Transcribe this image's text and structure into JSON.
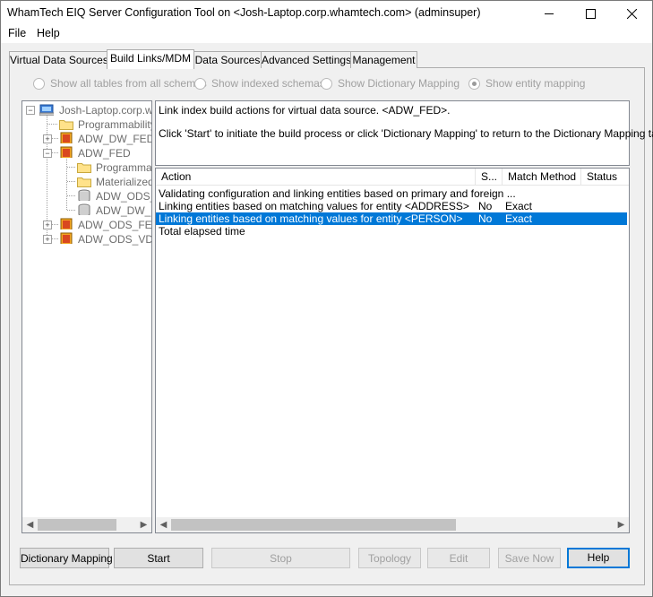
{
  "window": {
    "title": "WhamTech EIQ Server Configuration Tool on <Josh-Laptop.corp.whamtech.com> (adminsuper)",
    "minimize_glyph": "—",
    "maximize_glyph": "☐",
    "close_glyph": "✕"
  },
  "menu": [
    "File",
    "Help"
  ],
  "tabs": [
    "Virtual Data Sources",
    "Build Links/MDM",
    "Data Sources",
    "Advanced Settings",
    "Management"
  ],
  "active_tab": "Build Links/MDM",
  "radio_options": [
    {
      "label": "Show all tables from all schemas",
      "selected": false
    },
    {
      "label": "Show indexed schemas",
      "selected": false
    },
    {
      "label": "Show Dictionary Mapping",
      "selected": false
    },
    {
      "label": "Show entity mapping",
      "selected": true
    }
  ],
  "tree": {
    "root": "Josh-Laptop.corp.whamtech.com",
    "nodes": [
      "Programmability",
      "ADW_DW_FED",
      "ADW_FED",
      "Programmability",
      "Materialized",
      "ADW_ODS_",
      "ADW_DW_",
      "ADW_ODS_FED",
      "ADW_ODS_VD"
    ]
  },
  "info": {
    "line1": "Link index build actions for virtual data source. <ADW_FED>.",
    "line2": "Click 'Start' to initiate the build process or click 'Dictionary Mapping' to return to the Dictionary Mapping tab."
  },
  "list": {
    "columns": [
      "Action",
      "S...",
      "Match Method",
      "Status"
    ],
    "rows": [
      {
        "action": "Validating configuration and linking entities based on primary and foreign ...",
        "s": "",
        "match": "",
        "status": ""
      },
      {
        "action": "Linking entities based on matching values for entity <ADDRESS>",
        "s": "No",
        "match": "Exact",
        "status": ""
      },
      {
        "action": "Linking entities based on matching values for entity <PERSON>",
        "s": "No",
        "match": "Exact",
        "status": ""
      },
      {
        "action": "Total elapsed time",
        "s": "",
        "match": "",
        "status": ""
      }
    ],
    "selected_row": 2
  },
  "buttons": {
    "dictionary_mapping": "Dictionary Mapping",
    "start": "Start",
    "stop": "Stop",
    "topology": "Topology",
    "edit": "Edit",
    "save_now": "Save Now",
    "help": "Help"
  },
  "colors": {
    "selection": "#0078d7",
    "disabled_text": "#a0a0a0"
  }
}
